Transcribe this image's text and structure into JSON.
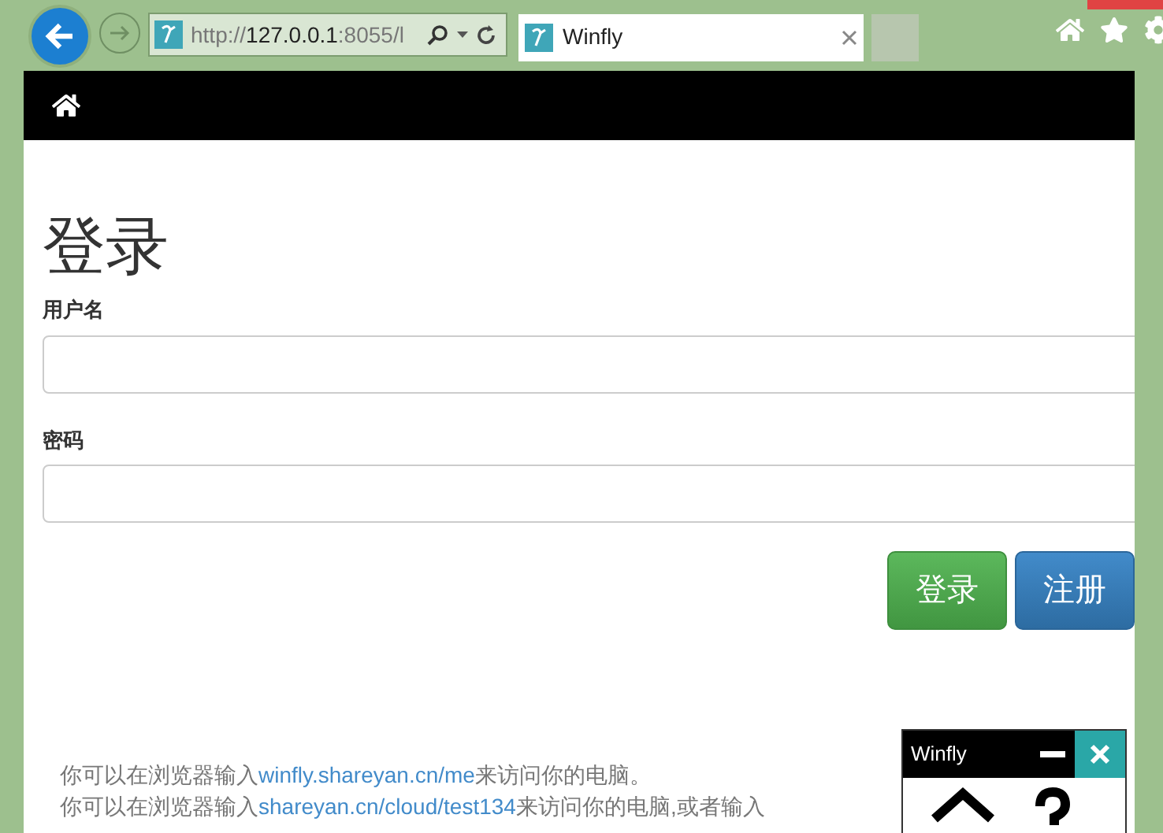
{
  "browser": {
    "address": {
      "scheme": "http://",
      "host": "127.0.0.1",
      "rest": ":8055/l"
    },
    "tab": {
      "title": "Winfly"
    }
  },
  "page": {
    "heading": "登录",
    "fields": [
      {
        "label": "用户名"
      },
      {
        "label": "密码"
      }
    ],
    "buttons": [
      {
        "label": "登录",
        "kind": "success"
      },
      {
        "label": "注册",
        "kind": "primary"
      }
    ],
    "notes": [
      [
        {
          "text": "你可以在浏览器输入"
        },
        {
          "text": "winfly.shareyan.cn/me",
          "link": true
        },
        {
          "text": "来访问你的电脑。"
        }
      ],
      [
        {
          "text": "你可以在浏览器输入"
        },
        {
          "text": "shareyan.cn/cloud/test134",
          "link": true
        },
        {
          "text": "来访问你的电脑,或者输入"
        }
      ]
    ]
  },
  "widget": {
    "title": "Winfly"
  }
}
